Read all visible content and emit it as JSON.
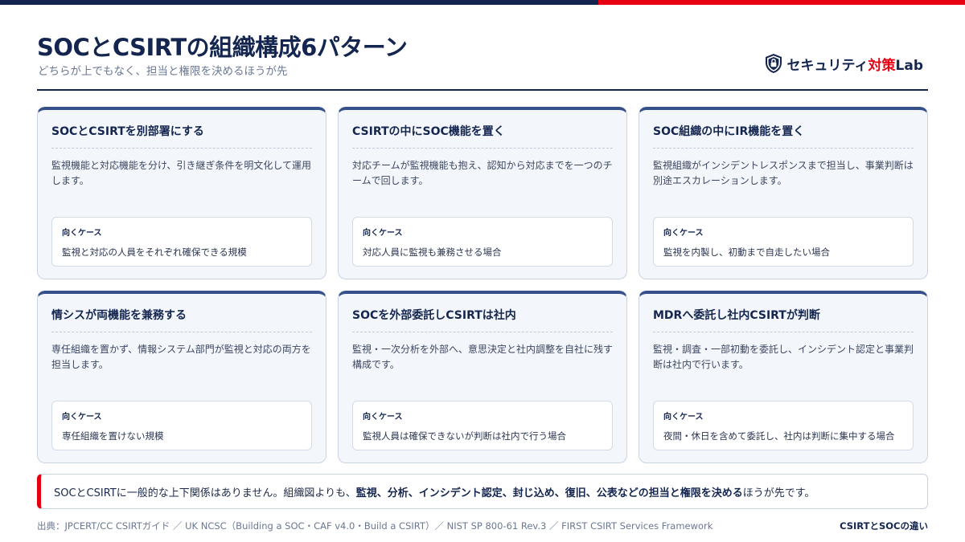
{
  "header": {
    "title": "SOCとCSIRTの組織構成6パターン",
    "subtitle": "どちらが上でもなく、担当と権限を決めるほうが先"
  },
  "logo": {
    "icon": "shield-lock-icon",
    "text_main": "セキュリティ",
    "text_accent": "対策",
    "text_tail": "Lab"
  },
  "colors": {
    "navy": "#14264f",
    "accent_red": "#e60012",
    "card_bg": "#f3f6fb",
    "card_top_border": "#35508a"
  },
  "cards": [
    {
      "title": "SOCとCSIRTを別部署にする",
      "description": "監視機能と対応機能を分け、引き継ぎ条件を明文化して運用します。",
      "case_label": "向くケース",
      "case_text": "監視と対応の人員をそれぞれ確保できる規模"
    },
    {
      "title": "CSIRTの中にSOC機能を置く",
      "description": "対応チームが監視機能も抱え、認知から対応までを一つのチームで回します。",
      "case_label": "向くケース",
      "case_text": "対応人員に監視も兼務させる場合"
    },
    {
      "title": "SOC組織の中にIR機能を置く",
      "description": "監視組織がインシデントレスポンスまで担当し、事業判断は別途エスカレーションします。",
      "case_label": "向くケース",
      "case_text": "監視を内製し、初動まで自走したい場合"
    },
    {
      "title": "情シスが両機能を兼務する",
      "description": "専任組織を置かず、情報システム部門が監視と対応の両方を担当します。",
      "case_label": "向くケース",
      "case_text": "専任組織を置けない規模"
    },
    {
      "title": "SOCを外部委託しCSIRTは社内",
      "description": "監視・一次分析を外部へ、意思決定と社内調整を自社に残す構成です。",
      "case_label": "向くケース",
      "case_text": "監視人員は確保できないが判断は社内で行う場合"
    },
    {
      "title": "MDRへ委託し社内CSIRTが判断",
      "description": "監視・調査・一部初動を委託し、インシデント認定と事業判断は社内で行います。",
      "case_label": "向くケース",
      "case_text": "夜間・休日を含めて委託し、社内は判断に集中する場合"
    }
  ],
  "note": {
    "lead": "SOCとCSIRTに一般的な上下関係はありません。組織図よりも、",
    "emphasis": "監視、分析、インシデント認定、封じ込め、復旧、公表などの担当と権限を決める",
    "tail": "ほうが先です。"
  },
  "footer": {
    "source": "出典：JPCERT/CC CSIRTガイド ／ UK NCSC（Building a SOC・CAF v4.0・Build a CSIRT）／ NIST SP 800-61 Rev.3 ／ FIRST CSIRT Services Framework",
    "tag": "CSIRTとSOCの違い"
  }
}
